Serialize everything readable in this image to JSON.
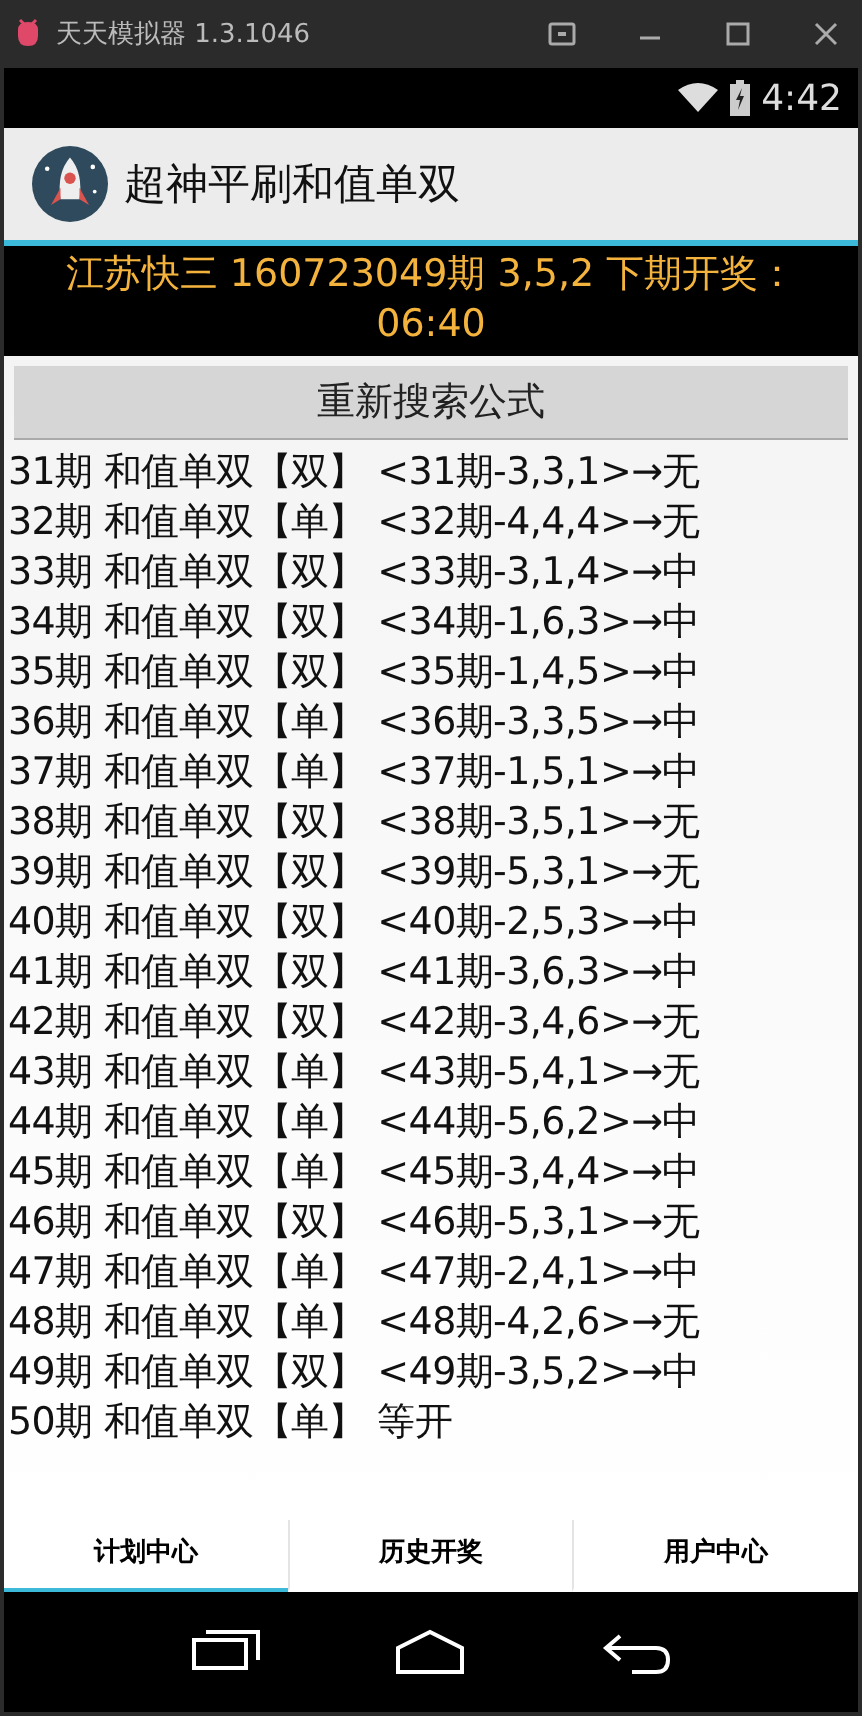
{
  "window": {
    "title": "天天模拟器 1.3.1046"
  },
  "status_bar": {
    "time": "4:42"
  },
  "app_bar": {
    "title": "超神平刷和值单双"
  },
  "banner": {
    "text": "江苏快三 160723049期 3,5,2 下期开奖：06:40"
  },
  "search_button": {
    "label": "重新搜索公式"
  },
  "rows": [
    "31期 和值单双【双】 <31期-3,3,1>→无",
    "32期 和值单双【单】 <32期-4,4,4>→无",
    "33期 和值单双【双】 <33期-3,1,4>→中",
    "34期 和值单双【双】 <34期-1,6,3>→中",
    "35期 和值单双【双】 <35期-1,4,5>→中",
    "36期 和值单双【单】 <36期-3,3,5>→中",
    "37期 和值单双【单】 <37期-1,5,1>→中",
    "38期 和值单双【双】 <38期-3,5,1>→无",
    "39期 和值单双【双】 <39期-5,3,1>→无",
    "40期 和值单双【双】 <40期-2,5,3>→中",
    "41期 和值单双【双】 <41期-3,6,3>→中",
    "42期 和值单双【双】 <42期-3,4,6>→无",
    "43期 和值单双【单】 <43期-5,4,1>→无",
    "44期 和值单双【单】 <44期-5,6,2>→中",
    "45期 和值单双【单】 <45期-3,4,4>→中",
    "46期 和值单双【双】 <46期-5,3,1>→无",
    "47期 和值单双【单】 <47期-2,4,1>→中",
    "48期 和值单双【单】 <48期-4,2,6>→无",
    "49期 和值单双【双】 <49期-3,5,2>→中",
    "50期 和值单双【单】 等开"
  ],
  "tabs": [
    {
      "label": "计划中心",
      "selected": true
    },
    {
      "label": "历史开奖",
      "selected": false
    },
    {
      "label": "用户中心",
      "selected": false
    }
  ]
}
